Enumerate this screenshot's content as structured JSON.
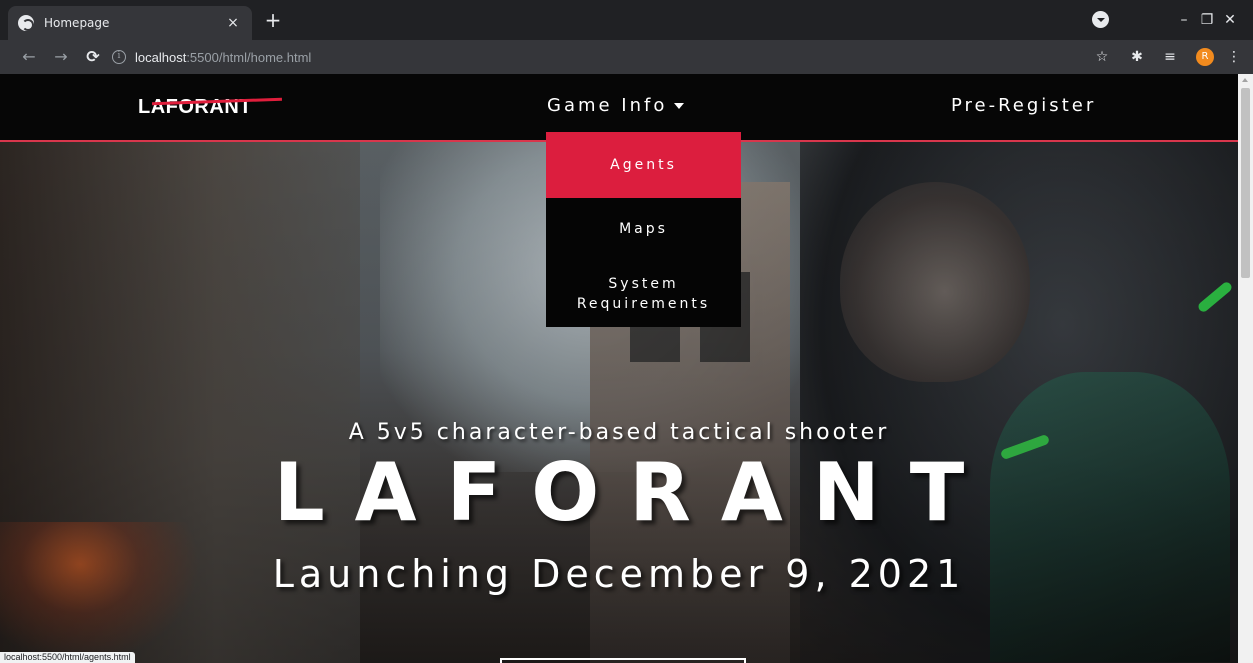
{
  "browser": {
    "tab_title": "Homepage",
    "tab_close": "×",
    "new_tab": "+",
    "url_host": "localhost",
    "url_path": ":5500/html/home.html",
    "status_url": "localhost:5500/html/agents.html",
    "profile_initial": "R",
    "window_minimize": "–",
    "window_restore": "❐",
    "window_close": "✕"
  },
  "site": {
    "logo": "LAFORANT",
    "nav": {
      "game_info": "Game Info",
      "pre_register": "Pre-Register"
    },
    "dropdown": {
      "agents": "Agents",
      "maps": "Maps",
      "system_line1": "System",
      "system_line2": "Requirements"
    },
    "hero": {
      "tagline": "A 5v5 character-based tactical shooter",
      "title": "LAFORANT",
      "launch": "Launching December 9, 2021"
    },
    "colors": {
      "accent": "#dc1e3e",
      "nav_bg": "#060606"
    }
  }
}
